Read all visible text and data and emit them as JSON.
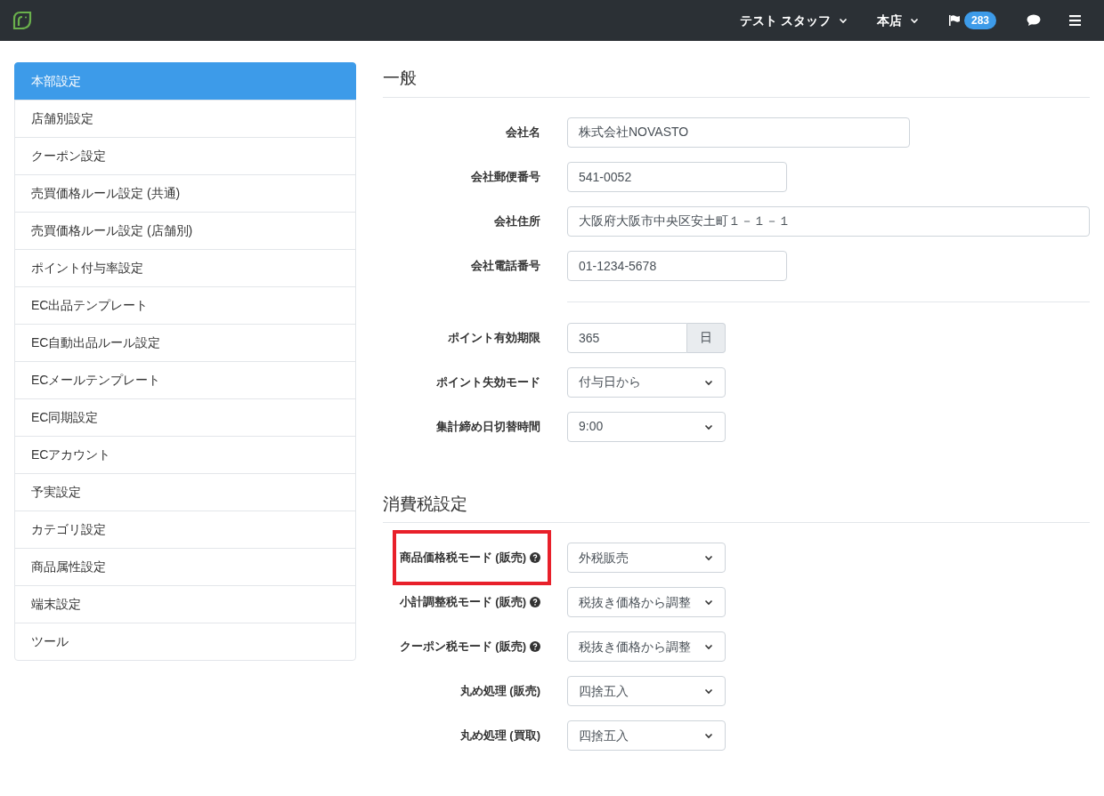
{
  "navbar": {
    "user": "テスト スタッフ",
    "store": "本店",
    "notification_count": "283"
  },
  "sidebar": {
    "items": [
      {
        "label": "本部設定",
        "selected": true
      },
      {
        "label": "店舗別設定",
        "selected": false
      },
      {
        "label": "クーポン設定",
        "selected": false
      },
      {
        "label": "売買価格ルール設定 (共通)",
        "selected": false
      },
      {
        "label": "売買価格ルール設定 (店舗別)",
        "selected": false
      },
      {
        "label": "ポイント付与率設定",
        "selected": false
      },
      {
        "label": "EC出品テンプレート",
        "selected": false
      },
      {
        "label": "EC自動出品ルール設定",
        "selected": false
      },
      {
        "label": "ECメールテンプレート",
        "selected": false
      },
      {
        "label": "EC同期設定",
        "selected": false
      },
      {
        "label": "ECアカウント",
        "selected": false
      },
      {
        "label": "予実設定",
        "selected": false
      },
      {
        "label": "カテゴリ設定",
        "selected": false
      },
      {
        "label": "商品属性設定",
        "selected": false
      },
      {
        "label": "端末設定",
        "selected": false
      },
      {
        "label": "ツール",
        "selected": false
      }
    ]
  },
  "sections": [
    {
      "title": "一般",
      "groups": [
        [
          {
            "label": "会社名",
            "kind": "text-long",
            "value": "株式会社NOVASTO",
            "help": false,
            "highlighted": false
          },
          {
            "label": "会社郵便番号",
            "kind": "text",
            "value": "541-0052",
            "help": false,
            "highlighted": false
          },
          {
            "label": "会社住所",
            "kind": "text-full",
            "value": "大阪府大阪市中央区安土町１－１－１",
            "help": false,
            "highlighted": false
          },
          {
            "label": "会社電話番号",
            "kind": "text",
            "value": "01-1234-5678",
            "help": false,
            "highlighted": false
          }
        ],
        [
          {
            "label": "ポイント有効期限",
            "kind": "addon",
            "value": "365",
            "unit": "日",
            "help": false,
            "highlighted": false
          },
          {
            "label": "ポイント失効モード",
            "kind": "select",
            "value": "付与日から",
            "help": false,
            "highlighted": false
          },
          {
            "label": "集計締め日切替時間",
            "kind": "select",
            "value": "9:00",
            "help": false,
            "highlighted": false
          }
        ]
      ]
    },
    {
      "title": "消費税設定",
      "groups": [
        [
          {
            "label": "商品価格税モード (販売)",
            "kind": "select",
            "value": "外税販売",
            "help": true,
            "highlighted": true
          },
          {
            "label": "小計調整税モード (販売)",
            "kind": "select",
            "value": "税抜き価格から調整",
            "help": true,
            "highlighted": false
          },
          {
            "label": "クーポン税モード (販売)",
            "kind": "select",
            "value": "税抜き価格から調整",
            "help": true,
            "highlighted": false
          },
          {
            "label": "丸め処理 (販売)",
            "kind": "select",
            "value": "四捨五入",
            "help": false,
            "highlighted": false
          },
          {
            "label": "丸め処理 (買取)",
            "kind": "select",
            "value": "四捨五入",
            "help": false,
            "highlighted": false
          }
        ]
      ]
    }
  ]
}
